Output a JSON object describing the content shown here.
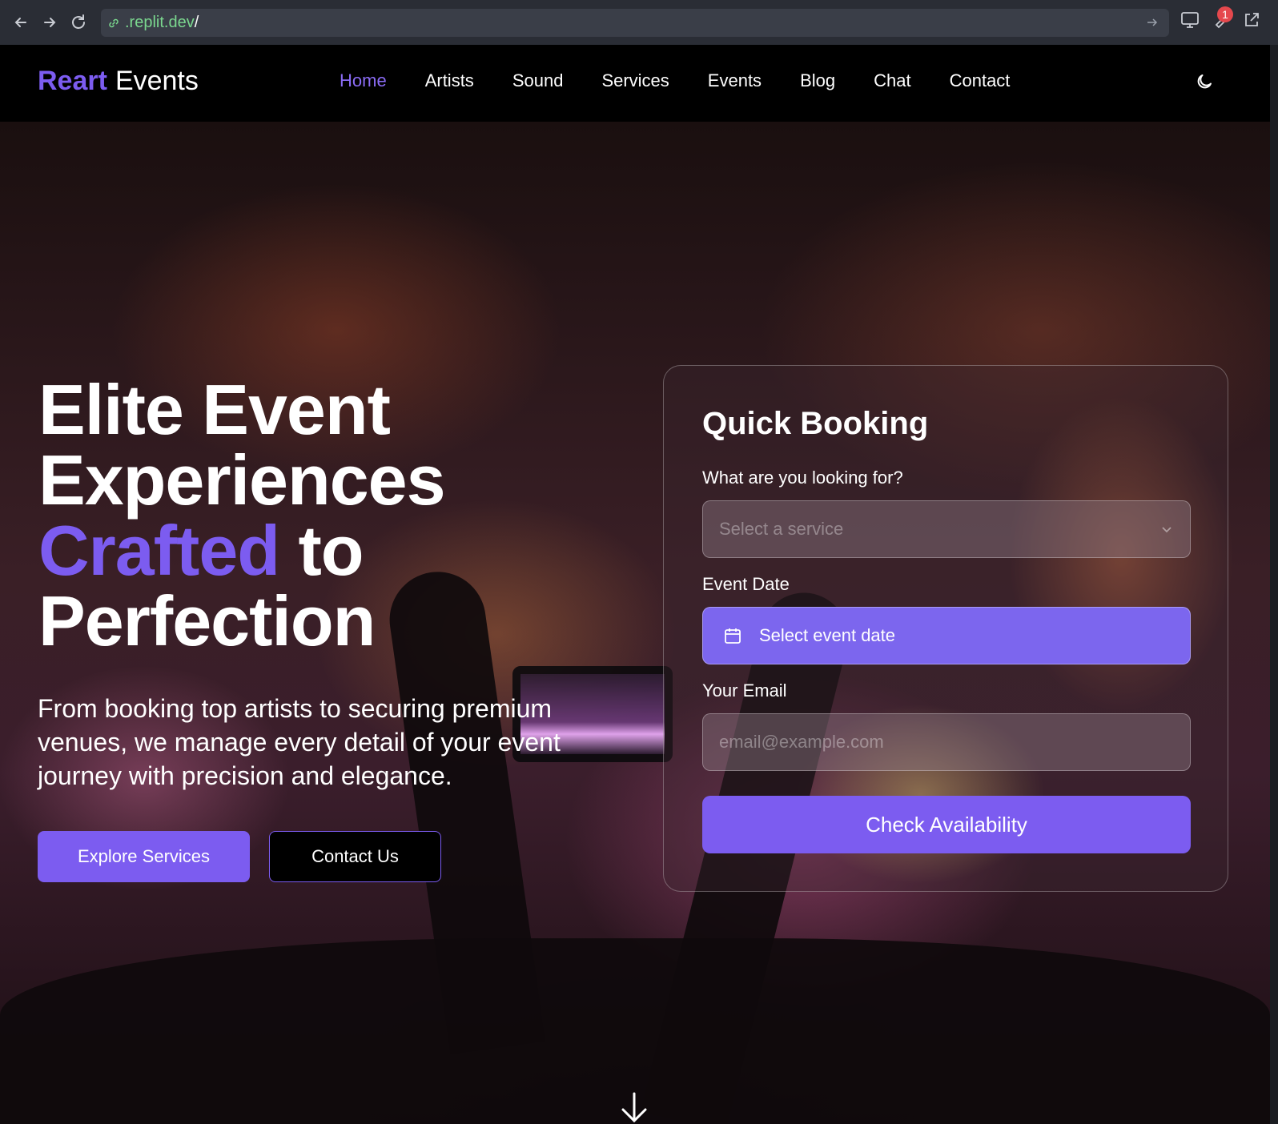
{
  "browser": {
    "url_host": ".replit.dev",
    "url_path": "/",
    "badge_count": "1"
  },
  "header": {
    "logo_accent": "Reart",
    "logo_rest": "Events",
    "nav": [
      {
        "label": "Home",
        "active": true
      },
      {
        "label": "Artists"
      },
      {
        "label": "Sound"
      },
      {
        "label": "Services"
      },
      {
        "label": "Events"
      },
      {
        "label": "Blog"
      },
      {
        "label": "Chat"
      },
      {
        "label": "Contact"
      }
    ],
    "theme_icon": "moon-icon"
  },
  "hero": {
    "title_line1": "Elite Event",
    "title_line2": "Experiences",
    "title_accent": "Crafted",
    "title_after_accent": "to",
    "title_line4": "Perfection",
    "subtitle": "From booking top artists to securing premium venues, we manage every detail of your event journey with precision and elegance.",
    "primary_button": "Explore Services",
    "secondary_button": "Contact Us"
  },
  "booking": {
    "title": "Quick Booking",
    "service_label": "What are you looking for?",
    "service_placeholder": "Select a service",
    "date_label": "Event Date",
    "date_placeholder": "Select event date",
    "email_label": "Your Email",
    "email_placeholder": "email@example.com",
    "submit_label": "Check Availability"
  },
  "colors": {
    "accent": "#7c5cf0",
    "nav_active": "#8b6cf5",
    "header_bg": "#000000"
  }
}
